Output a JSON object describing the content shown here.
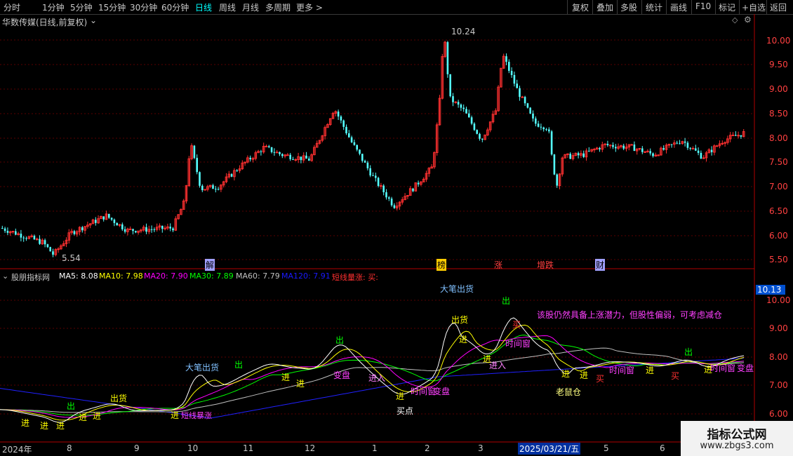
{
  "toolbar": {
    "timeframes": [
      "分时",
      "1分钟",
      "5分钟",
      "15分钟",
      "30分钟",
      "60分钟",
      "日线",
      "周线",
      "月线",
      "多周期",
      "更多 >"
    ],
    "active_timeframe": "日线",
    "right_buttons": [
      "复权",
      "叠加",
      "多股",
      "统计",
      "画线",
      "F10",
      "标记",
      "+自选",
      "返回"
    ]
  },
  "main_chart": {
    "stock_title": "华数传媒(日线,前复权)",
    "price_axis": [
      "10.00",
      "9.50",
      "9.00",
      "8.50",
      "8.00",
      "7.50",
      "7.00",
      "6.50",
      "6.00",
      "5.50"
    ],
    "high_label": "10.24",
    "low_label": "5.54",
    "event_markers": [
      {
        "label": "​",
        "color": "#ff3030"
      },
      {
        "label": "解",
        "color": "#c0c0ff"
      },
      {
        "label": "榜",
        "color": "#ffcc00"
      },
      {
        "label": "涨",
        "color": "#ff4040"
      },
      {
        "label": "增跌",
        "color": "#ff4040"
      },
      {
        "label": "财",
        "color": "#c0c0ff"
      }
    ]
  },
  "indicator": {
    "name": "股朋指标网",
    "ma_values": [
      {
        "label": "MA5: 8.08",
        "color": "#ffffff"
      },
      {
        "label": "MA10: 7.98",
        "color": "#ffff00"
      },
      {
        "label": "MA20: 7.90",
        "color": "#ff00ff"
      },
      {
        "label": "MA30: 7.89",
        "color": "#00ff00"
      },
      {
        "label": "MA60: 7.79",
        "color": "#c0c0c0"
      },
      {
        "label": "MA120: 7.91",
        "color": "#0000ff"
      },
      {
        "label": "短线量涨: 买:",
        "color": "#ff3030"
      }
    ],
    "axis": [
      "10.00",
      "9.00",
      "8.00",
      "7.00",
      "6.00"
    ],
    "current_value": "10.13",
    "comment": "该股仍然具备上涨潜力，但股性偏弱，可考虑减仓",
    "signals": {
      "big_sell": "大笔出货",
      "sell": "出",
      "sell_goods": "出货",
      "buy_in": "进",
      "buy": "买",
      "buy_point": "买点",
      "jin_ru": "进入",
      "old_mouse": "老鼠仓",
      "time_window": "时间窗",
      "breakthrough": "突破",
      "change_plate": "变盘",
      "short_up": "短线暴涨"
    }
  },
  "date_axis": {
    "labels": [
      "2024年",
      "8",
      "9",
      "10",
      "11",
      "12",
      "1",
      "2",
      "3",
      "2025/03/21/五",
      "5",
      "6"
    ]
  },
  "watermark": {
    "title": "指标公式网",
    "url": "www.zbgs3.com"
  },
  "colors": {
    "up": "#ff3030",
    "down": "#54ffff",
    "axis": "#b00000"
  }
}
